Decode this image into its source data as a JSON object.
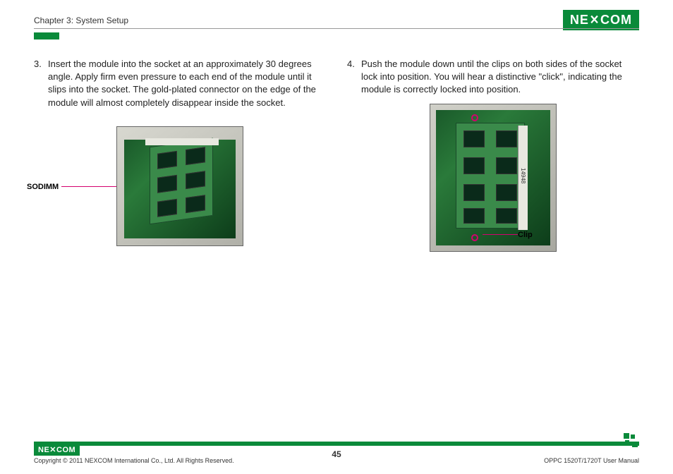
{
  "header": {
    "chapter": "Chapter 3: System Setup",
    "logo_text": "NEXCOM"
  },
  "left_column": {
    "step_number": "3.",
    "step_text": "Insert the module into the socket at an approximately 30 degrees angle. Apply firm even pressure to each end of the module until it slips into the socket. The gold-plated connector on the edge of the module will almost completely disappear inside the socket.",
    "callout_label": "SODIMM"
  },
  "right_column": {
    "step_number": "4.",
    "step_text": "Push the module down until the clips on both sides of the socket lock into position. You will hear a distinctive \"click\", indicating the module is correctly locked into position.",
    "callout_label": "Clip"
  },
  "footer": {
    "logo_text": "NEXCOM",
    "copyright": "Copyright © 2011 NEXCOM International Co., Ltd. All Rights Reserved.",
    "page_number": "45",
    "manual_title": "OPPC 1520T/1720T User Manual"
  }
}
